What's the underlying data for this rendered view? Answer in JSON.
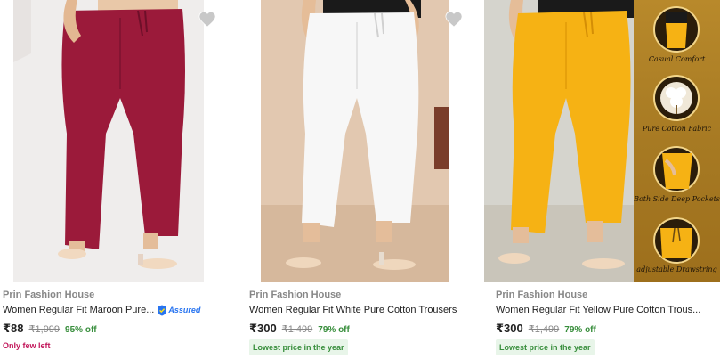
{
  "products": [
    {
      "brand": "Prin Fashion House",
      "title": "Women Regular Fit Maroon Pure...",
      "assured_label": "Assured",
      "price": "₹88",
      "mrp": "₹1,999",
      "discount": "95% off",
      "tag": "Only few left",
      "garment_color": "#9b1a3a"
    },
    {
      "brand": "Prin Fashion House",
      "title": "Women Regular Fit White Pure Cotton Trousers",
      "price": "₹300",
      "mrp": "₹1,499",
      "discount": "79% off",
      "tag": "Lowest price in the year",
      "garment_color": "#f7f7f7"
    },
    {
      "brand": "Prin Fashion House",
      "title": "Women Regular Fit Yellow Pure Cotton Trous...",
      "price": "₹300",
      "mrp": "₹1,499",
      "discount": "79% off",
      "tag": "Lowest price in the year",
      "garment_color": "#f6b214"
    }
  ],
  "feature_panel": {
    "items": [
      "Casual Comfort",
      "Pure Cotton Fabric",
      "Both Side Deep Pockets",
      "adjustable Drawstring"
    ]
  },
  "colors": {
    "wishlist_heart": "#c8c8c8",
    "discount_green": "#388e3c",
    "scarcity_pink": "#c2185b",
    "assured_blue": "#2874f0"
  },
  "icons": [
    "heart-icon",
    "assured-badge-icon"
  ]
}
